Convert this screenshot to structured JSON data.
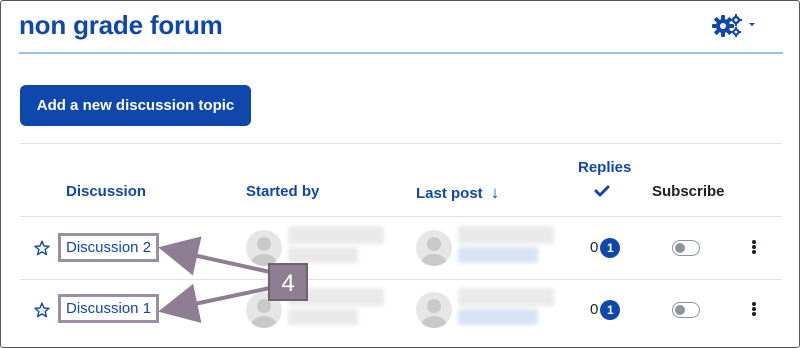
{
  "page": {
    "title": "non grade forum",
    "settings_icon": "gear-icon",
    "add_button": "Add a new discussion topic"
  },
  "table": {
    "headers": {
      "discussion": "Discussion",
      "started_by": "Started by",
      "last_post": "Last post",
      "sort_indicator": "↓",
      "replies": "Replies",
      "subscribe": "Subscribe"
    },
    "rows": [
      {
        "title": "Discussion 2",
        "replies": "0",
        "unread": "1",
        "subscribed": false
      },
      {
        "title": "Discussion 1",
        "replies": "0",
        "unread": "1",
        "subscribed": false
      }
    ]
  },
  "callout": {
    "label": "4",
    "color": "#8f7e93"
  },
  "colors": {
    "brand": "#0f47ad",
    "callout": "#8f7e93"
  }
}
